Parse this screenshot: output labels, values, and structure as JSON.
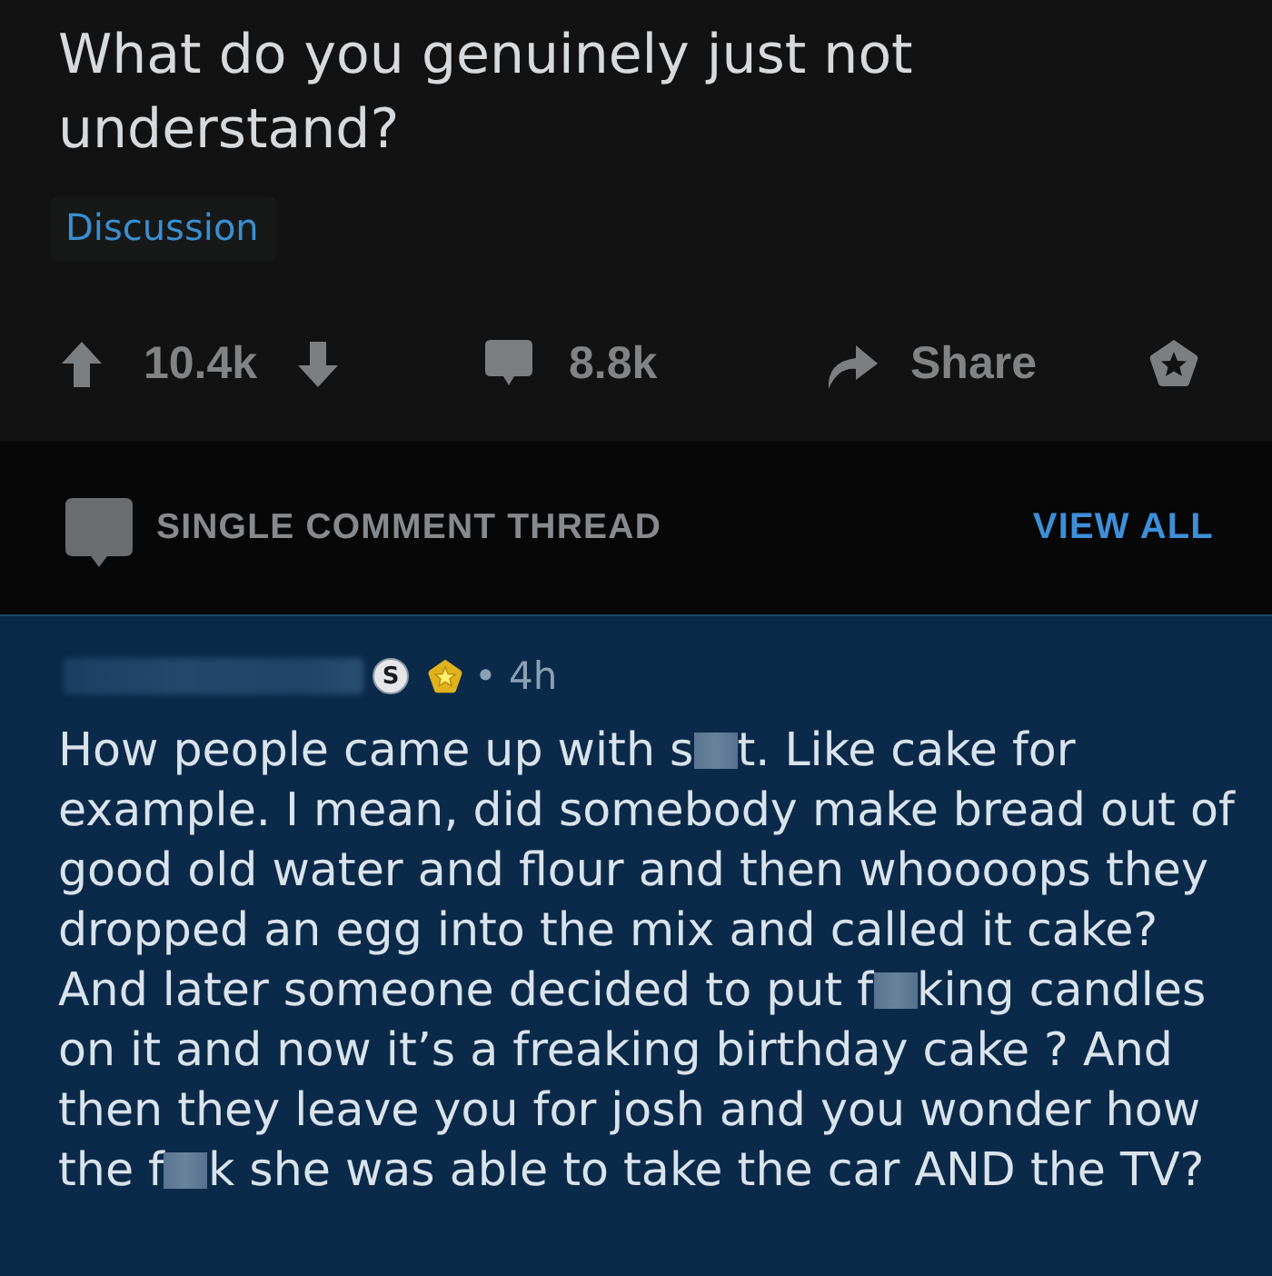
{
  "post": {
    "title": "What do you genuinely just not understand?",
    "flair": "Discussion",
    "score": "10.4k",
    "comment_count": "8.8k",
    "share_label": "Share"
  },
  "thread_bar": {
    "label": "SINGLE COMMENT THREAD",
    "action": "VIEW ALL"
  },
  "comment": {
    "user_badge": "S",
    "time": "• 4h",
    "body": [
      {
        "kind": "text",
        "text": "How people came up with s"
      },
      {
        "kind": "censored"
      },
      {
        "kind": "text",
        "text": "t. Like cake for example. I mean, did somebody make bread out of good old water and flour and then whoooops they dropped an egg into the mix and called it cake? And later someone decided to put f"
      },
      {
        "kind": "censored"
      },
      {
        "kind": "text",
        "text": "king candles on it and now it’s a freaking birthday cake ? And then they leave you for josh and you wonder how the f"
      },
      {
        "kind": "censored"
      },
      {
        "kind": "text",
        "text": "k she was able to take the car AND the TV?"
      }
    ]
  }
}
